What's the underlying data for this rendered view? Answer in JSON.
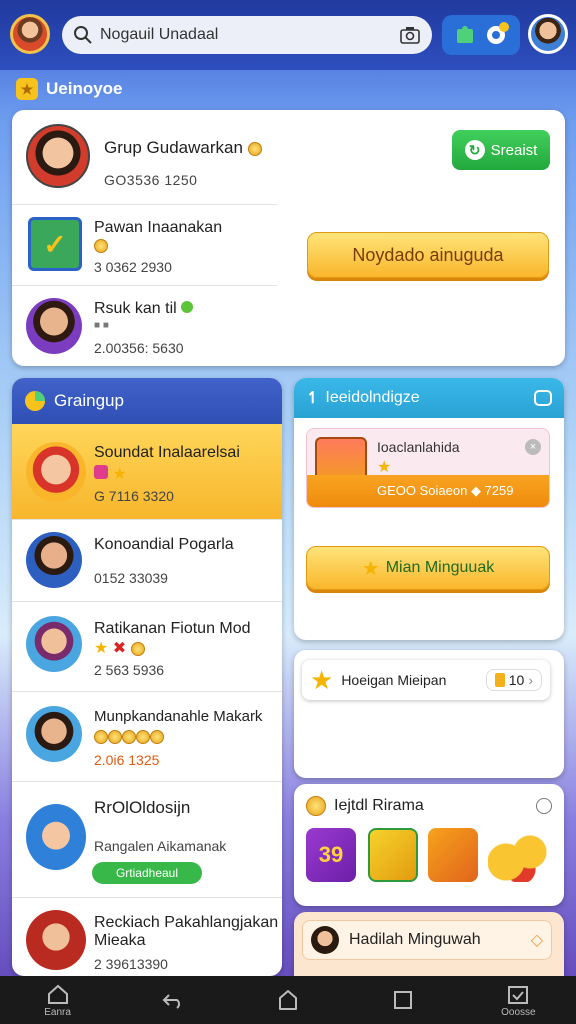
{
  "header": {
    "search_text": "Nogauil Unadaal"
  },
  "section1": {
    "label": "Ueinoyoe"
  },
  "group_card": {
    "title": "Grup Gudawarkan",
    "code": "GO3536 1250",
    "button": "Sreaist",
    "rows": [
      {
        "title": "Pawan Inaanakan",
        "value": "3 0362 2930"
      },
      {
        "title": "Rsuk kan til",
        "value": "2.00356: 5630"
      }
    ],
    "action_button": "Noydado ainuguda"
  },
  "list": {
    "header": "Graingup",
    "items": [
      {
        "title": "Soundat Inalaarelsai",
        "value": "G 7116 3320"
      },
      {
        "title": "Konoandial Pogarla",
        "value": "0152 33039"
      },
      {
        "title": "Ratikanan Fiotun Mod",
        "value": "2 563 5936"
      },
      {
        "title": "Munpkandanahle Makark",
        "value": "2.0i6 1325"
      },
      {
        "title": "RrOlOldosijn",
        "value": "Rangalen Aikamanak",
        "badge": "Grtiadheaul"
      },
      {
        "title": "Reckiach Pakahlangjakan",
        "title2": "Mieaka",
        "value": "2 39613390"
      }
    ]
  },
  "right_panel": {
    "header": "Ieeidolndigze",
    "promo_title": "Ioaclanlahida",
    "promo_price": "GEOO Soiaeon ◆ 7259",
    "main_button": "Mian Minguuak",
    "item_label": "Hoeigan Mieipan",
    "item_count": "10"
  },
  "rewards": {
    "title": "Iejtdl Rirama",
    "tile1": "39"
  },
  "hadiah": {
    "label": "Hadilah Minguwah"
  },
  "nav": {
    "home": "Eanra",
    "back": "",
    "center": "",
    "recent": "",
    "right": "Ooosse"
  },
  "colors": {
    "accent": "#2f4fb5",
    "green": "#2fb84a",
    "yellow": "#f9b62b",
    "teal": "#2aa8d8"
  }
}
